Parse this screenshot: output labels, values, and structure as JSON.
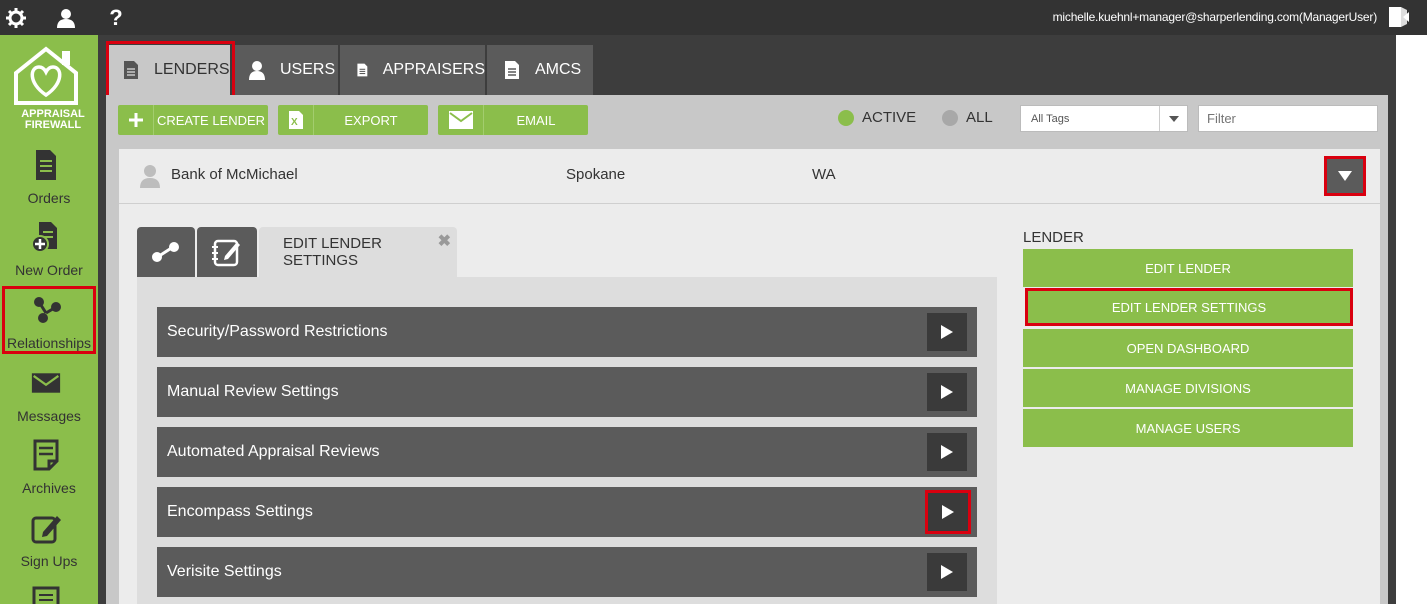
{
  "topbar": {
    "user_email": "michelle.kuehnl+manager@sharperlending.com(ManagerUser)",
    "icons": [
      "gear-icon",
      "user-icon",
      "help-icon",
      "logout-icon"
    ]
  },
  "sidebar": {
    "logo_text_line1": "APPRAISAL",
    "logo_text_line2": "FIREWALL",
    "items": [
      {
        "label": "Orders",
        "icon": "document-icon"
      },
      {
        "label": "New Order",
        "icon": "new-document-icon"
      },
      {
        "label": "Relationships",
        "icon": "relationships-icon"
      },
      {
        "label": "Messages",
        "icon": "envelope-icon"
      },
      {
        "label": "Archives",
        "icon": "archive-icon"
      },
      {
        "label": "Sign Ups",
        "icon": "edit-icon"
      }
    ]
  },
  "tabs": [
    {
      "label": "LENDERS",
      "active": true
    },
    {
      "label": "USERS",
      "active": false
    },
    {
      "label": "APPRAISERS",
      "active": false
    },
    {
      "label": "AMCS",
      "active": false
    }
  ],
  "toolbar": {
    "create_label": "CREATE LENDER",
    "export_label": "EXPORT",
    "email_label": "EMAIL",
    "active_label": "ACTIVE",
    "all_label": "ALL",
    "tags_value": "All Tags",
    "filter_placeholder": "Filter"
  },
  "lender": {
    "name": "Bank of McMichael",
    "city": "Spokane",
    "state": "WA"
  },
  "subtabs": {
    "active_label": "EDIT LENDER SETTINGS"
  },
  "settings": [
    {
      "label": "Security/Password Restrictions"
    },
    {
      "label": "Manual Review Settings"
    },
    {
      "label": "Automated Appraisal Reviews"
    },
    {
      "label": "Encompass Settings"
    },
    {
      "label": "Verisite Settings"
    }
  ],
  "lender_actions": {
    "heading": "LENDER",
    "buttons": [
      {
        "label": "EDIT LENDER"
      },
      {
        "label": "EDIT LENDER SETTINGS"
      },
      {
        "label": "OPEN DASHBOARD"
      },
      {
        "label": "MANAGE DIVISIONS"
      },
      {
        "label": "MANAGE USERS"
      }
    ]
  },
  "colors": {
    "brand_green": "#8bbe4b",
    "dark_gray": "#5b5b5b",
    "highlight_red": "#d9000f"
  }
}
